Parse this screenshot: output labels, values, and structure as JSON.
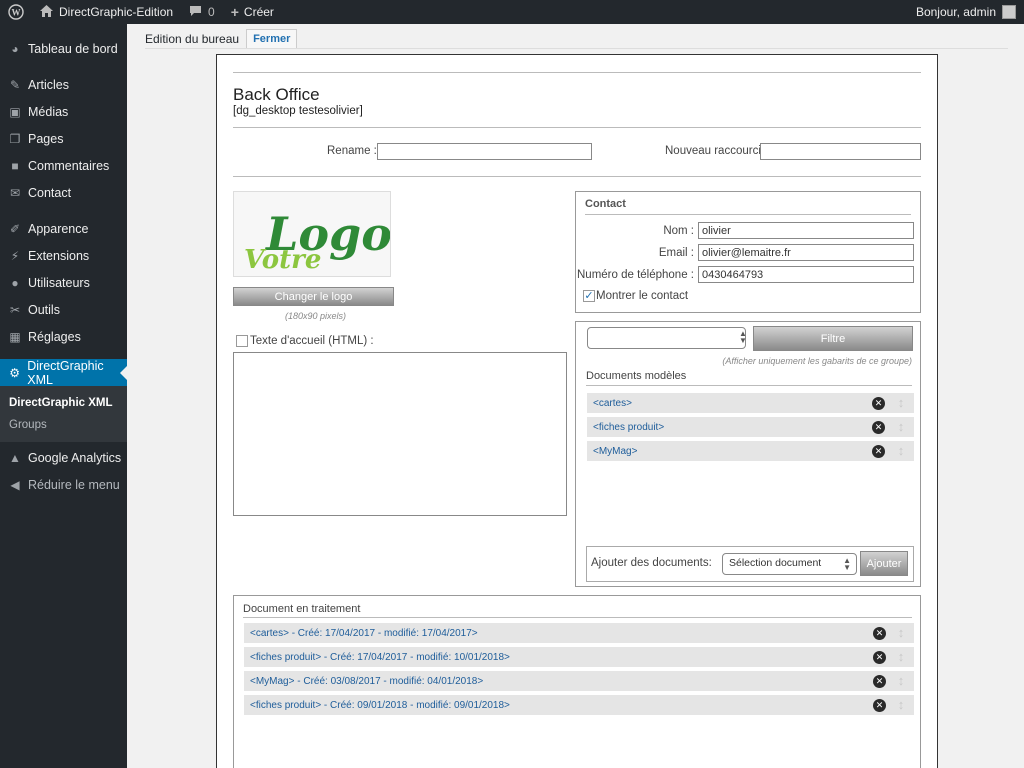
{
  "adminbar": {
    "site_name": "DirectGraphic-Edition",
    "comments_count": "0",
    "create_label": "Créer",
    "greeting": "Bonjour, admin"
  },
  "sidebar": {
    "items": [
      {
        "label": "Tableau de bord",
        "icon": "dashboard-icon"
      },
      {
        "label": "Articles",
        "icon": "pin-icon"
      },
      {
        "label": "Médias",
        "icon": "media-icon"
      },
      {
        "label": "Pages",
        "icon": "pages-icon"
      },
      {
        "label": "Commentaires",
        "icon": "comments-icon"
      },
      {
        "label": "Contact",
        "icon": "mail-icon"
      },
      {
        "label": "Apparence",
        "icon": "brush-icon"
      },
      {
        "label": "Extensions",
        "icon": "plugin-icon"
      },
      {
        "label": "Utilisateurs",
        "icon": "users-icon"
      },
      {
        "label": "Outils",
        "icon": "wrench-icon"
      },
      {
        "label": "Réglages",
        "icon": "settings-icon"
      },
      {
        "label": "DirectGraphic XML",
        "icon": "gear-icon"
      },
      {
        "label": "Google Analytics",
        "icon": "analytics-icon"
      },
      {
        "label": "Réduire le menu",
        "icon": "collapse-icon"
      }
    ],
    "submenu": [
      "DirectGraphic XML",
      "Groups"
    ]
  },
  "header": {
    "title": "Edition du bureau",
    "close_label": "Fermer"
  },
  "panel": {
    "title": "Back Office",
    "subtitle": "[dg_desktop testesolivier]",
    "rename_label": "Rename :",
    "rename_value": "",
    "shortcut_label": "Nouveau raccourci :",
    "shortcut_value": "",
    "logo_text_top": "Logo",
    "logo_text_bottom": "Votre",
    "change_logo_label": "Changer le logo",
    "logo_size_note": "(180x90 pixels)",
    "welcome_label": "Texte d'accueil (HTML) :",
    "welcome_checked": false
  },
  "contact": {
    "title": "Contact",
    "name_label": "Nom :",
    "name_value": "olivier",
    "email_label": "Email :",
    "email_value": "olivier@lemaitre.fr",
    "phone_label": "Numéro de téléphone :",
    "phone_value": "0430464793",
    "show_label": "Montrer le contact",
    "show_checked": true
  },
  "templates": {
    "group_select_value": "",
    "filter_label": "Filtre",
    "filter_note": "(Afficher uniquement les gabarits de ce groupe)",
    "section_title": "Documents modèles",
    "items": [
      "<cartes>",
      "<fiches produit>",
      "<MyMag>"
    ],
    "add_label": "Ajouter des documents:",
    "doc_select_value": "Sélection document",
    "add_button_label": "Ajouter"
  },
  "processing": {
    "title": "Document en traitement",
    "items": [
      "<cartes> - Créé: 17/04/2017 - modifié: 17/04/2017>",
      "<fiches produit> - Créé: 17/04/2017 - modifié: 10/01/2018>",
      "<MyMag> - Créé: 03/08/2017 - modifié: 04/01/2018>",
      "<fiches produit> - Créé: 09/01/2018 - modifié: 09/01/2018>"
    ]
  },
  "colors": {
    "accent": "#0073aa",
    "admin_bg": "#23282d",
    "link": "#1e5d9a",
    "logo_dark": "#2f8a37",
    "logo_light": "#8cc63f"
  }
}
